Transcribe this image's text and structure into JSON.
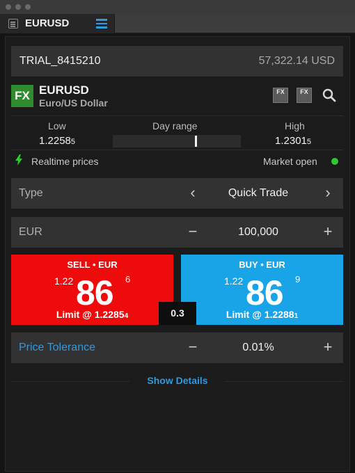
{
  "tab": {
    "title": "EURUSD"
  },
  "account": {
    "id": "TRIAL_8415210",
    "balance": "57,322.14 USD"
  },
  "instrument": {
    "badge": "FX",
    "symbol": "EURUSD",
    "description": "Euro/US Dollar",
    "chart_icon_1": "FX",
    "chart_icon_2": "FX"
  },
  "day_range": {
    "low_label": "Low",
    "low_main": "1.2258",
    "low_pip": "5",
    "range_label": "Day range",
    "high_label": "High",
    "high_main": "1.2301",
    "high_pip": "5",
    "current_position_fraction": 0.65
  },
  "status": {
    "realtime": "Realtime prices",
    "market": "Market open",
    "market_color": "#32c832"
  },
  "type_row": {
    "label": "Type",
    "value": "Quick Trade",
    "prev": "‹",
    "next": "›"
  },
  "amount_row": {
    "label": "EUR",
    "value": "100,000",
    "minus": "−",
    "plus": "+"
  },
  "sell": {
    "label": "SELL • EUR",
    "prefix": "1.22",
    "big": "86",
    "pip": "6",
    "limit_main": "Limit @ 1.2285",
    "limit_pip": "4",
    "color": "#ee0b0b"
  },
  "buy": {
    "label": "BUY • EUR",
    "prefix": "1.22",
    "big": "86",
    "pip": "9",
    "limit_main": "Limit @ 1.2288",
    "limit_pip": "1",
    "color": "#1aa4e8"
  },
  "spread": "0.3",
  "tolerance_row": {
    "label": "Price Tolerance",
    "value": "0.01%",
    "minus": "−",
    "plus": "+"
  },
  "show_details": "Show Details",
  "accent": "#2e9ae0"
}
